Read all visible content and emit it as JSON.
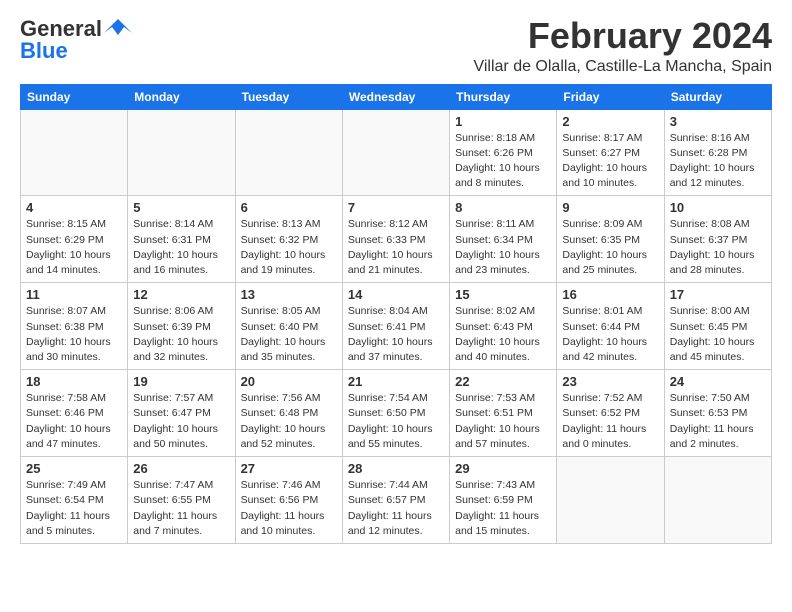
{
  "logo": {
    "line1": "General",
    "line2": "Blue"
  },
  "title": "February 2024",
  "subtitle": "Villar de Olalla, Castille-La Mancha, Spain",
  "weekdays": [
    "Sunday",
    "Monday",
    "Tuesday",
    "Wednesday",
    "Thursday",
    "Friday",
    "Saturday"
  ],
  "weeks": [
    [
      {
        "day": "",
        "info": ""
      },
      {
        "day": "",
        "info": ""
      },
      {
        "day": "",
        "info": ""
      },
      {
        "day": "",
        "info": ""
      },
      {
        "day": "1",
        "info": "Sunrise: 8:18 AM\nSunset: 6:26 PM\nDaylight: 10 hours\nand 8 minutes."
      },
      {
        "day": "2",
        "info": "Sunrise: 8:17 AM\nSunset: 6:27 PM\nDaylight: 10 hours\nand 10 minutes."
      },
      {
        "day": "3",
        "info": "Sunrise: 8:16 AM\nSunset: 6:28 PM\nDaylight: 10 hours\nand 12 minutes."
      }
    ],
    [
      {
        "day": "4",
        "info": "Sunrise: 8:15 AM\nSunset: 6:29 PM\nDaylight: 10 hours\nand 14 minutes."
      },
      {
        "day": "5",
        "info": "Sunrise: 8:14 AM\nSunset: 6:31 PM\nDaylight: 10 hours\nand 16 minutes."
      },
      {
        "day": "6",
        "info": "Sunrise: 8:13 AM\nSunset: 6:32 PM\nDaylight: 10 hours\nand 19 minutes."
      },
      {
        "day": "7",
        "info": "Sunrise: 8:12 AM\nSunset: 6:33 PM\nDaylight: 10 hours\nand 21 minutes."
      },
      {
        "day": "8",
        "info": "Sunrise: 8:11 AM\nSunset: 6:34 PM\nDaylight: 10 hours\nand 23 minutes."
      },
      {
        "day": "9",
        "info": "Sunrise: 8:09 AM\nSunset: 6:35 PM\nDaylight: 10 hours\nand 25 minutes."
      },
      {
        "day": "10",
        "info": "Sunrise: 8:08 AM\nSunset: 6:37 PM\nDaylight: 10 hours\nand 28 minutes."
      }
    ],
    [
      {
        "day": "11",
        "info": "Sunrise: 8:07 AM\nSunset: 6:38 PM\nDaylight: 10 hours\nand 30 minutes."
      },
      {
        "day": "12",
        "info": "Sunrise: 8:06 AM\nSunset: 6:39 PM\nDaylight: 10 hours\nand 32 minutes."
      },
      {
        "day": "13",
        "info": "Sunrise: 8:05 AM\nSunset: 6:40 PM\nDaylight: 10 hours\nand 35 minutes."
      },
      {
        "day": "14",
        "info": "Sunrise: 8:04 AM\nSunset: 6:41 PM\nDaylight: 10 hours\nand 37 minutes."
      },
      {
        "day": "15",
        "info": "Sunrise: 8:02 AM\nSunset: 6:43 PM\nDaylight: 10 hours\nand 40 minutes."
      },
      {
        "day": "16",
        "info": "Sunrise: 8:01 AM\nSunset: 6:44 PM\nDaylight: 10 hours\nand 42 minutes."
      },
      {
        "day": "17",
        "info": "Sunrise: 8:00 AM\nSunset: 6:45 PM\nDaylight: 10 hours\nand 45 minutes."
      }
    ],
    [
      {
        "day": "18",
        "info": "Sunrise: 7:58 AM\nSunset: 6:46 PM\nDaylight: 10 hours\nand 47 minutes."
      },
      {
        "day": "19",
        "info": "Sunrise: 7:57 AM\nSunset: 6:47 PM\nDaylight: 10 hours\nand 50 minutes."
      },
      {
        "day": "20",
        "info": "Sunrise: 7:56 AM\nSunset: 6:48 PM\nDaylight: 10 hours\nand 52 minutes."
      },
      {
        "day": "21",
        "info": "Sunrise: 7:54 AM\nSunset: 6:50 PM\nDaylight: 10 hours\nand 55 minutes."
      },
      {
        "day": "22",
        "info": "Sunrise: 7:53 AM\nSunset: 6:51 PM\nDaylight: 10 hours\nand 57 minutes."
      },
      {
        "day": "23",
        "info": "Sunrise: 7:52 AM\nSunset: 6:52 PM\nDaylight: 11 hours\nand 0 minutes."
      },
      {
        "day": "24",
        "info": "Sunrise: 7:50 AM\nSunset: 6:53 PM\nDaylight: 11 hours\nand 2 minutes."
      }
    ],
    [
      {
        "day": "25",
        "info": "Sunrise: 7:49 AM\nSunset: 6:54 PM\nDaylight: 11 hours\nand 5 minutes."
      },
      {
        "day": "26",
        "info": "Sunrise: 7:47 AM\nSunset: 6:55 PM\nDaylight: 11 hours\nand 7 minutes."
      },
      {
        "day": "27",
        "info": "Sunrise: 7:46 AM\nSunset: 6:56 PM\nDaylight: 11 hours\nand 10 minutes."
      },
      {
        "day": "28",
        "info": "Sunrise: 7:44 AM\nSunset: 6:57 PM\nDaylight: 11 hours\nand 12 minutes."
      },
      {
        "day": "29",
        "info": "Sunrise: 7:43 AM\nSunset: 6:59 PM\nDaylight: 11 hours\nand 15 minutes."
      },
      {
        "day": "",
        "info": ""
      },
      {
        "day": "",
        "info": ""
      }
    ]
  ]
}
